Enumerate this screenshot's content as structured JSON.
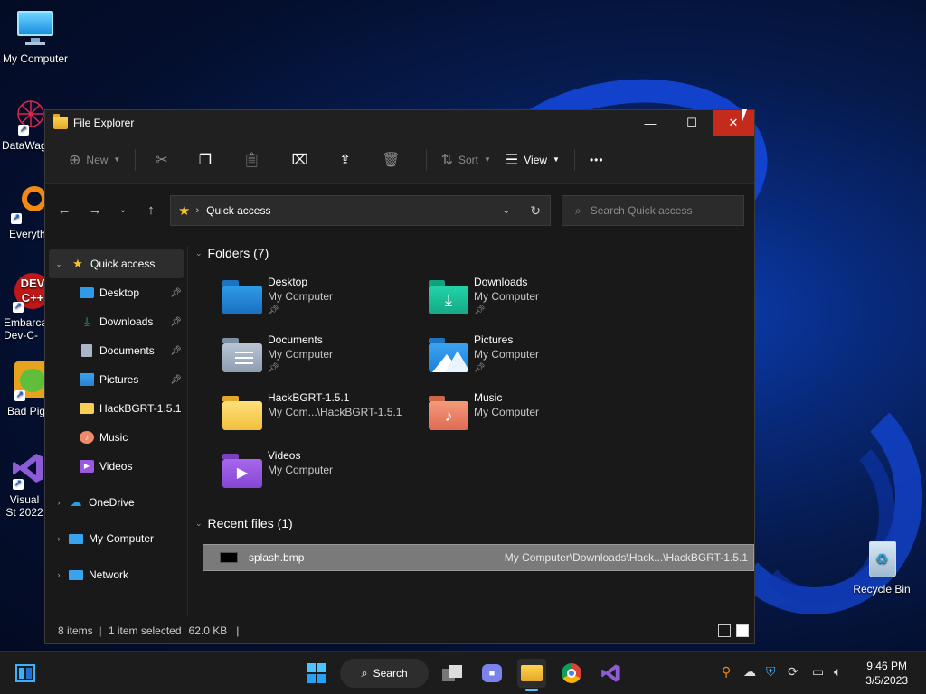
{
  "desktop": {
    "icons": [
      {
        "label": "My Computer"
      },
      {
        "label": "DataWag"
      },
      {
        "label": "Everyth"
      },
      {
        "label": "Embarca Dev-C-"
      },
      {
        "label": "Bad Pig"
      },
      {
        "label": "Visual St 2022"
      },
      {
        "label": "Recycle Bin"
      }
    ]
  },
  "window": {
    "title": "File Explorer",
    "controls": {
      "minimize": "—",
      "maximize": "☐",
      "close": "✕"
    }
  },
  "toolbar": {
    "new_label": "New",
    "sort_label": "Sort",
    "view_label": "View",
    "more_label": "•••"
  },
  "address": {
    "location": "Quick access",
    "search_placeholder": "Search Quick access"
  },
  "sidebar": {
    "items": [
      {
        "label": "Quick access",
        "icon": "star-icon"
      },
      {
        "label": "Desktop",
        "icon": "desktop-icon"
      },
      {
        "label": "Downloads",
        "icon": "download-icon"
      },
      {
        "label": "Documents",
        "icon": "document-icon"
      },
      {
        "label": "Pictures",
        "icon": "picture-icon"
      },
      {
        "label": "HackBGRT-1.5.1",
        "icon": "folder-icon"
      },
      {
        "label": "Music",
        "icon": "music-icon"
      },
      {
        "label": "Videos",
        "icon": "video-icon"
      },
      {
        "label": "OneDrive",
        "icon": "cloud-icon"
      },
      {
        "label": "My Computer",
        "icon": "computer-icon"
      },
      {
        "label": "Network",
        "icon": "network-icon"
      }
    ]
  },
  "main": {
    "folders_header": "Folders (7)",
    "folders": [
      {
        "name": "Desktop",
        "location": "My Computer",
        "pinned": true,
        "color": "#2f9be8"
      },
      {
        "name": "Downloads",
        "location": "My Computer",
        "pinned": true,
        "color": "#1ec8a0"
      },
      {
        "name": "Documents",
        "location": "My Computer",
        "pinned": true,
        "color": "#a9b6c7"
      },
      {
        "name": "Pictures",
        "location": "My Computer",
        "pinned": true,
        "color": "#3aa3f0"
      },
      {
        "name": "HackBGRT-1.5.1",
        "location": "My Com...\\HackBGRT-1.5.1",
        "pinned": false,
        "color": "#f7cf55"
      },
      {
        "name": "Music",
        "location": "My Computer",
        "pinned": false,
        "color": "#ef8a6a"
      },
      {
        "name": "Videos",
        "location": "My Computer",
        "pinned": false,
        "color": "#9a5ae0"
      }
    ],
    "recent_header": "Recent files (1)",
    "recent": [
      {
        "name": "splash.bmp",
        "path": "My Computer\\Downloads\\Hack...\\HackBGRT-1.5.1"
      }
    ]
  },
  "status": {
    "items": "8 items",
    "selected": "1 item selected",
    "size": "62.0 KB",
    "cursor": "|"
  },
  "taskbar": {
    "search_label": "Search",
    "time": "9:46 PM",
    "date": "3/5/2023"
  }
}
